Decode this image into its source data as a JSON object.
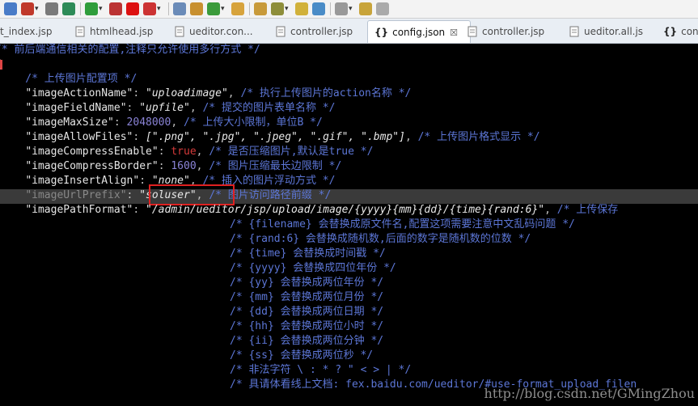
{
  "toolbar": {
    "buttons": [
      {
        "icon": "debug-icon",
        "color": "#4a7cc7"
      },
      {
        "icon": "skip-breakpoints-icon",
        "color": "#c0392b"
      },
      {
        "icon": "tasks-icon",
        "color": "#7a7a7a"
      },
      {
        "icon": "bug-icon",
        "color": "#2e8b57"
      },
      {
        "icon": "run-icon",
        "color": "#2f9d3b"
      },
      {
        "icon": "external-tools-icon",
        "color": "#b33"
      },
      {
        "icon": "stop-icon",
        "color": "#d11"
      },
      {
        "icon": "server-icon",
        "color": "#c33"
      },
      {
        "icon": "new-project-icon",
        "color": "#6a8bb8"
      },
      {
        "icon": "package-icon",
        "color": "#c8902f"
      },
      {
        "icon": "new-class-icon",
        "color": "#3b9b3b"
      },
      {
        "icon": "open-folder-icon",
        "color": "#d7a33c"
      },
      {
        "icon": "open-type-icon",
        "color": "#c89a3a"
      },
      {
        "icon": "search-icon",
        "color": "#8e8e3a"
      },
      {
        "icon": "annotation-icon",
        "color": "#d1b13a"
      },
      {
        "icon": "globe-icon",
        "color": "#4a8cc7"
      },
      {
        "icon": "navigate-icon",
        "color": "#999"
      },
      {
        "icon": "back-icon",
        "color": "#c8a43a"
      },
      {
        "icon": "forward-icon",
        "color": "#aaa"
      }
    ]
  },
  "tabs": [
    {
      "label": "t_index.jsp",
      "active": false
    },
    {
      "label": "htmlhead.jsp",
      "active": false
    },
    {
      "label": "ueditor.con...",
      "active": false
    },
    {
      "label": "controller.jsp",
      "active": false
    },
    {
      "label": "config.json",
      "active": true,
      "close": "☒"
    },
    {
      "label": "controller.jsp",
      "active": false
    },
    {
      "label": "ueditor.all.js",
      "active": false
    },
    {
      "label": "con",
      "active": false
    }
  ],
  "code": {
    "line0": "/* 前后端通信相关的配置,注释只允许使用多行方式 */",
    "line1": "{",
    "line2": "    /* 上传图片配置项 */",
    "l3_key": "\"imageActionName\"",
    "l3_val": "\"uploadimage\"",
    "l3_cm": "/* 执行上传图片的action名称 */",
    "l4_key": "\"imageFieldName\"",
    "l4_val": "\"upfile\"",
    "l4_cm": "/* 提交的图片表单名称 */",
    "l5_key": "\"imageMaxSize\"",
    "l5_val": "2048000",
    "l5_cm": "/* 上传大小限制，单位B */",
    "l6_key": "\"imageAllowFiles\"",
    "l6_vals": "[\".png\", \".jpg\", \".jpeg\", \".gif\", \".bmp\"]",
    "l6_cm": "/* 上传图片格式显示 */",
    "l7_key": "\"imageCompressEnable\"",
    "l7_val": "true",
    "l7_cm": "/* 是否压缩图片,默认是true */",
    "l8_key": "\"imageCompressBorder\"",
    "l8_val": "1600",
    "l8_cm": "/* 图片压缩最长边限制 */",
    "l9_key": "\"imageInsertAlign\"",
    "l9_val": "\"none\"",
    "l9_cm": "/* 插入的图片浮动方式 */",
    "l10_key": "\"imageUrlPrefix\"",
    "l10_val": "\"soluser\"",
    "l10_cm": "/* 图片访问路径前缀 */",
    "l11_key": "\"imagePathFormat\"",
    "l11_val": "\"/admin/ueditor/jsp/upload/image/{yyyy}{mm}{dd}/{time}{rand:6}\"",
    "l11_cm": "/* 上传保存",
    "fmt": [
      "/* {filename} 会替换成原文件名,配置这项需要注意中文乱码问题 */",
      "/* {rand:6} 会替换成随机数,后面的数字是随机数的位数 */",
      "/* {time} 会替换成时间戳 */",
      "/* {yyyy} 会替换成四位年份 */",
      "/* {yy} 会替换成两位年份 */",
      "/* {mm} 会替换成两位月份 */",
      "/* {dd} 会替换成两位日期 */",
      "/* {hh} 会替换成两位小时 */",
      "/* {ii} 会替换成两位分钟 */",
      "/* {ss} 会替换成两位秒 */",
      "/* 非法字符 \\ : * ? \" < > | */",
      "/* 具请体看线上文档: fex.baidu.com/ueditor/#use-format_upload_filen"
    ]
  },
  "watermark": "http://blog.csdn.net/GMingZhou"
}
